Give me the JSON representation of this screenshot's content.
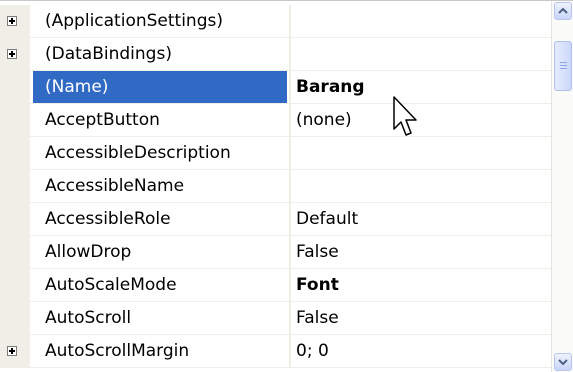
{
  "properties": [
    {
      "name": "(ApplicationSettings)",
      "value": "",
      "expandable": true,
      "bold": false,
      "selected": false
    },
    {
      "name": "(DataBindings)",
      "value": "",
      "expandable": true,
      "bold": false,
      "selected": false
    },
    {
      "name": "(Name)",
      "value": "Barang",
      "expandable": false,
      "bold": true,
      "selected": true
    },
    {
      "name": "AcceptButton",
      "value": "(none)",
      "expandable": false,
      "bold": false,
      "selected": false
    },
    {
      "name": "AccessibleDescription",
      "value": "",
      "expandable": false,
      "bold": false,
      "selected": false
    },
    {
      "name": "AccessibleName",
      "value": "",
      "expandable": false,
      "bold": false,
      "selected": false
    },
    {
      "name": "AccessibleRole",
      "value": "Default",
      "expandable": false,
      "bold": false,
      "selected": false
    },
    {
      "name": "AllowDrop",
      "value": "False",
      "expandable": false,
      "bold": false,
      "selected": false
    },
    {
      "name": "AutoScaleMode",
      "value": "Font",
      "expandable": false,
      "bold": true,
      "selected": false
    },
    {
      "name": "AutoScroll",
      "value": "False",
      "expandable": false,
      "bold": false,
      "selected": false
    },
    {
      "name": "AutoScrollMargin",
      "value": "0; 0",
      "expandable": true,
      "bold": false,
      "selected": false
    }
  ],
  "colors": {
    "selection": "#316ac5",
    "margin": "#f0efe7",
    "scrollbar_accent": "#c9d6fb"
  },
  "icons": {
    "expand": "plus-box-icon",
    "scroll_up": "chevron-up-icon",
    "scroll_down": "chevron-down-icon",
    "cursor": "mouse-pointer-icon"
  }
}
